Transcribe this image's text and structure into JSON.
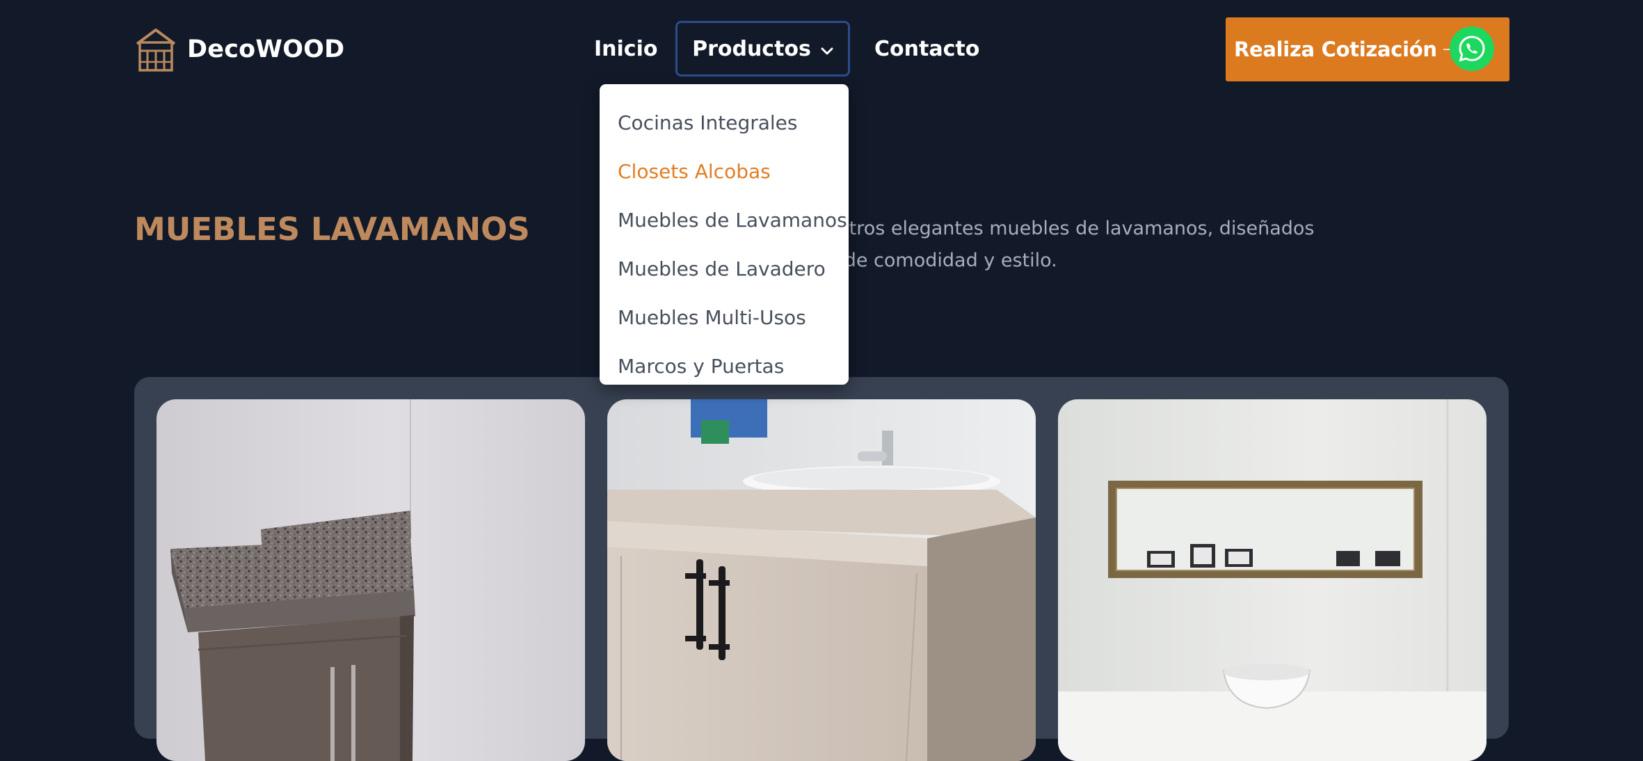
{
  "header": {
    "brand": "DecoWOOD",
    "logo_icon": "house-logo-icon",
    "nav": {
      "inicio": "Inicio",
      "productos": "Productos",
      "contacto": "Contacto"
    },
    "cta_label": "Realiza Cotización",
    "cta_arrow": "→",
    "cta_icon": "whatsapp-icon"
  },
  "dropdown": {
    "items": [
      "Cocinas Integrales",
      "Closets Alcobas",
      "Muebles de Lavamanos",
      "Muebles de Lavadero",
      "Muebles Multi-Usos",
      "Marcos y Puertas"
    ],
    "highlighted_index": 1
  },
  "hero": {
    "title": "MUEBLES LAVAMANOS",
    "description_line1": "funcionalidad con nuestros elegantes muebles de lavamanos, diseñados",
    "description_line2": "o de baño en un oasis de comodidad y estilo."
  },
  "gallery": {
    "images": [
      {
        "name": "vanity-granite-top"
      },
      {
        "name": "vanity-sink-cabinet"
      },
      {
        "name": "mirror-wall-vessel-sink"
      }
    ]
  },
  "colors": {
    "background": "#121929",
    "accent_orange": "#dc7a20",
    "title_tan": "#be8a5d",
    "whatsapp_green": "#1ed75f",
    "gallery_panel": "#374152"
  }
}
